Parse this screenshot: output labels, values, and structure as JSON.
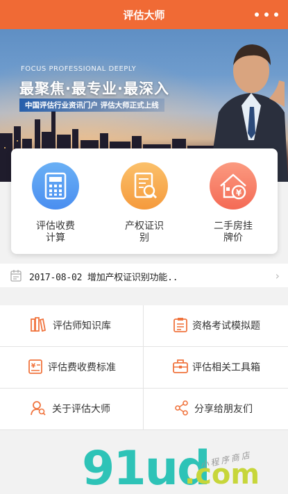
{
  "app": {
    "title": "评估大师"
  },
  "banner": {
    "english_tagline": "FOCUS PROFESSIONAL DEEPLY",
    "headline": "最聚焦·最专业·最深入",
    "subline": "中国评估行业资讯门户 评估大师正式上线"
  },
  "features": [
    {
      "label_line1": "评估收费",
      "label_line2": "计算",
      "icon": "calculator-icon",
      "color_from": "#6ab0f5",
      "color_to": "#4a8ef0"
    },
    {
      "label_line1": "产权证识",
      "label_line2": "别",
      "icon": "document-scan-icon",
      "color_from": "#fbc06a",
      "color_to": "#f59a3c"
    },
    {
      "label_line1": "二手房挂",
      "label_line2": "牌价",
      "icon": "house-price-icon",
      "color_from": "#fb9a80",
      "color_to": "#f46a55"
    }
  ],
  "notice": {
    "text": "2017-08-02 增加产权证识别功能..",
    "icon": "calendar-icon"
  },
  "menu": [
    {
      "label": "评估师知识库",
      "icon": "books-icon"
    },
    {
      "label": "资格考试模拟题",
      "icon": "checklist-icon"
    },
    {
      "label": "评估费收费标准",
      "icon": "fee-document-icon"
    },
    {
      "label": "评估相关工具箱",
      "icon": "toolbox-icon"
    },
    {
      "label": "关于评估大师",
      "icon": "user-search-icon"
    },
    {
      "label": "分享给朋友们",
      "icon": "share-icon"
    }
  ],
  "watermark": {
    "brand": "91ud",
    "suffix": ".com",
    "tag": "小程序商店"
  },
  "colors": {
    "accent": "#f06a35",
    "icon_orange": "#f0743e"
  }
}
